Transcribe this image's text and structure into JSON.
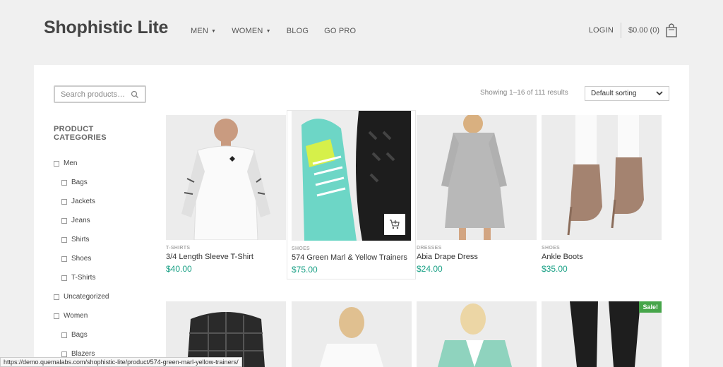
{
  "header": {
    "logo": "Shophistic Lite",
    "nav": [
      {
        "label": "MEN",
        "has_dropdown": true
      },
      {
        "label": "WOMEN",
        "has_dropdown": true
      },
      {
        "label": "BLOG",
        "has_dropdown": false
      },
      {
        "label": "GO PRO",
        "has_dropdown": false
      }
    ],
    "login": "LOGIN",
    "cart_total": "$0.00 (0)",
    "cart_icon": "shopping-bag-icon"
  },
  "search": {
    "placeholder": "Search products…"
  },
  "categories": {
    "heading": "PRODUCT CATEGORIES",
    "items": [
      {
        "label": "Men",
        "level": 0
      },
      {
        "label": "Bags",
        "level": 1
      },
      {
        "label": "Jackets",
        "level": 1
      },
      {
        "label": "Jeans",
        "level": 1
      },
      {
        "label": "Shirts",
        "level": 1
      },
      {
        "label": "Shoes",
        "level": 1
      },
      {
        "label": "T-Shirts",
        "level": 1
      },
      {
        "label": "Uncategorized",
        "level": 0
      },
      {
        "label": "Women",
        "level": 0
      },
      {
        "label": "Bags",
        "level": 1
      },
      {
        "label": "Blazers",
        "level": 1
      }
    ]
  },
  "results": {
    "count_text": "Showing 1–16 of 111 results"
  },
  "sort": {
    "selected": "Default sorting"
  },
  "products": [
    {
      "category": "T-SHIRTS",
      "name": "3/4 Length Sleeve T-Shirt",
      "price": "$40.00"
    },
    {
      "category": "SHOES",
      "name": "574 Green Marl & Yellow Trainers",
      "price": "$75.00"
    },
    {
      "category": "DRESSES",
      "name": "Abia Drape Dress",
      "price": "$24.00"
    },
    {
      "category": "SHOES",
      "name": "Ankle Boots",
      "price": "$35.00"
    }
  ],
  "second_row": {
    "sale_badge": "Sale!"
  },
  "status_bar": {
    "url": "https://demo.quemalabs.com/shophistic-lite/product/574-green-marl-yellow-trainers/"
  },
  "colors": {
    "accent": "#1aa186",
    "sale": "#46a54a"
  }
}
